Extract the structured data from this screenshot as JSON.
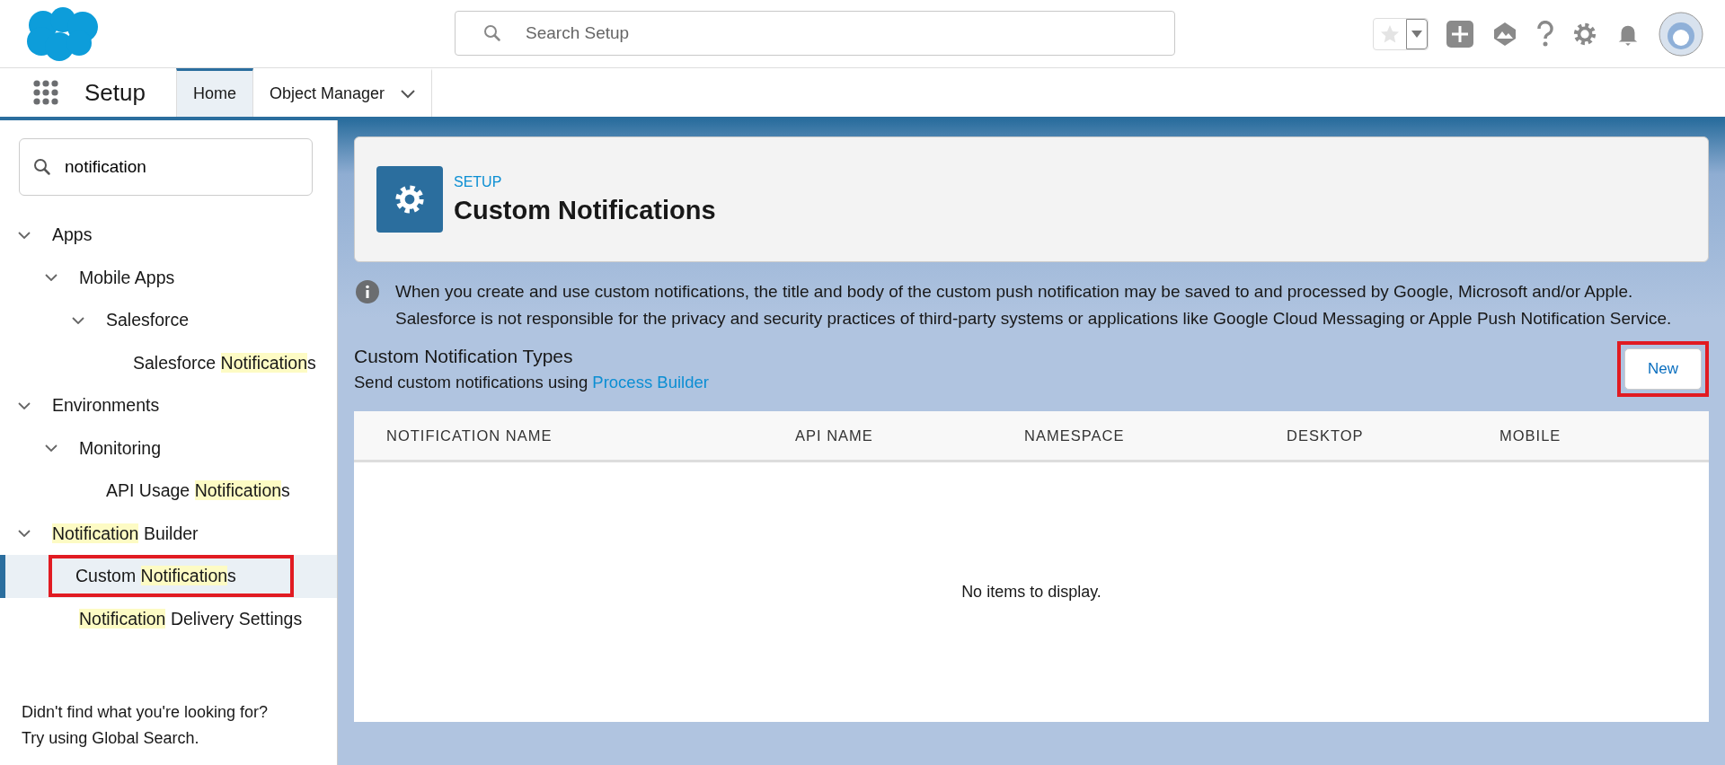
{
  "header": {
    "search": {
      "placeholder": "Search Setup"
    }
  },
  "nav": {
    "app_name": "Setup",
    "tabs": [
      {
        "label": "Home",
        "selected": true,
        "has_menu": false
      },
      {
        "label": "Object Manager",
        "selected": false,
        "has_menu": true
      }
    ]
  },
  "sidebar": {
    "search": {
      "value": "notification"
    },
    "tree": [
      {
        "parts": [
          {
            "text": "Apps",
            "highlight": false
          }
        ],
        "expanded": true,
        "selected": false,
        "callout": false,
        "children": [
          {
            "parts": [
              {
                "text": "Mobile Apps",
                "highlight": false
              }
            ],
            "expanded": true,
            "selected": false,
            "callout": false,
            "children": [
              {
                "parts": [
                  {
                    "text": "Salesforce",
                    "highlight": false
                  }
                ],
                "expanded": true,
                "selected": false,
                "callout": false,
                "children": [
                  {
                    "parts": [
                      {
                        "text": "Salesforce ",
                        "highlight": false
                      },
                      {
                        "text": "Notification",
                        "highlight": true
                      },
                      {
                        "text": "s",
                        "highlight": false
                      }
                    ],
                    "selected": false,
                    "callout": false
                  }
                ]
              }
            ]
          }
        ]
      },
      {
        "parts": [
          {
            "text": "Environments",
            "highlight": false
          }
        ],
        "expanded": true,
        "selected": false,
        "callout": false,
        "children": [
          {
            "parts": [
              {
                "text": "Monitoring",
                "highlight": false
              }
            ],
            "expanded": true,
            "selected": false,
            "callout": false,
            "children": [
              {
                "parts": [
                  {
                    "text": "API Usage ",
                    "highlight": false
                  },
                  {
                    "text": "Notification",
                    "highlight": true
                  },
                  {
                    "text": "s",
                    "highlight": false
                  }
                ],
                "selected": false,
                "callout": false
              }
            ]
          }
        ]
      },
      {
        "parts": [
          {
            "text": "Notification",
            "highlight": true
          },
          {
            "text": " Builder",
            "highlight": false
          }
        ],
        "expanded": true,
        "selected": false,
        "callout": false,
        "children": [
          {
            "parts": [
              {
                "text": "Custom ",
                "highlight": false
              },
              {
                "text": "Notification",
                "highlight": true
              },
              {
                "text": "s",
                "highlight": false
              }
            ],
            "selected": true,
            "callout": true
          },
          {
            "parts": [
              {
                "text": "Notification",
                "highlight": true
              },
              {
                "text": " Delivery Settings",
                "highlight": false
              }
            ],
            "selected": false,
            "callout": false
          }
        ]
      }
    ],
    "footer": [
      "Didn't find what you're looking for?",
      "Try using Global Search."
    ]
  },
  "page_header": {
    "eyebrow": "SETUP",
    "title": "Custom Notifications"
  },
  "info": {
    "lines": [
      "When you create and use custom notifications, the title and body of the custom push notification may be saved to and processed by Google, Microsoft and/or Apple.",
      "Salesforce is not responsible for the privacy and security practices of third-party systems or applications like Google Cloud Messaging or Apple Push Notification Service."
    ]
  },
  "section": {
    "title": "Custom Notification Types",
    "subtitle": "Send custom notifications using ",
    "link": "Process Builder",
    "new_button": {
      "label": "New",
      "callout": true
    }
  },
  "table": {
    "columns": [
      "NOTIFICATION NAME",
      "API NAME",
      "NAMESPACE",
      "DESKTOP",
      "MOBILE"
    ],
    "empty_message": "No items to display."
  }
}
